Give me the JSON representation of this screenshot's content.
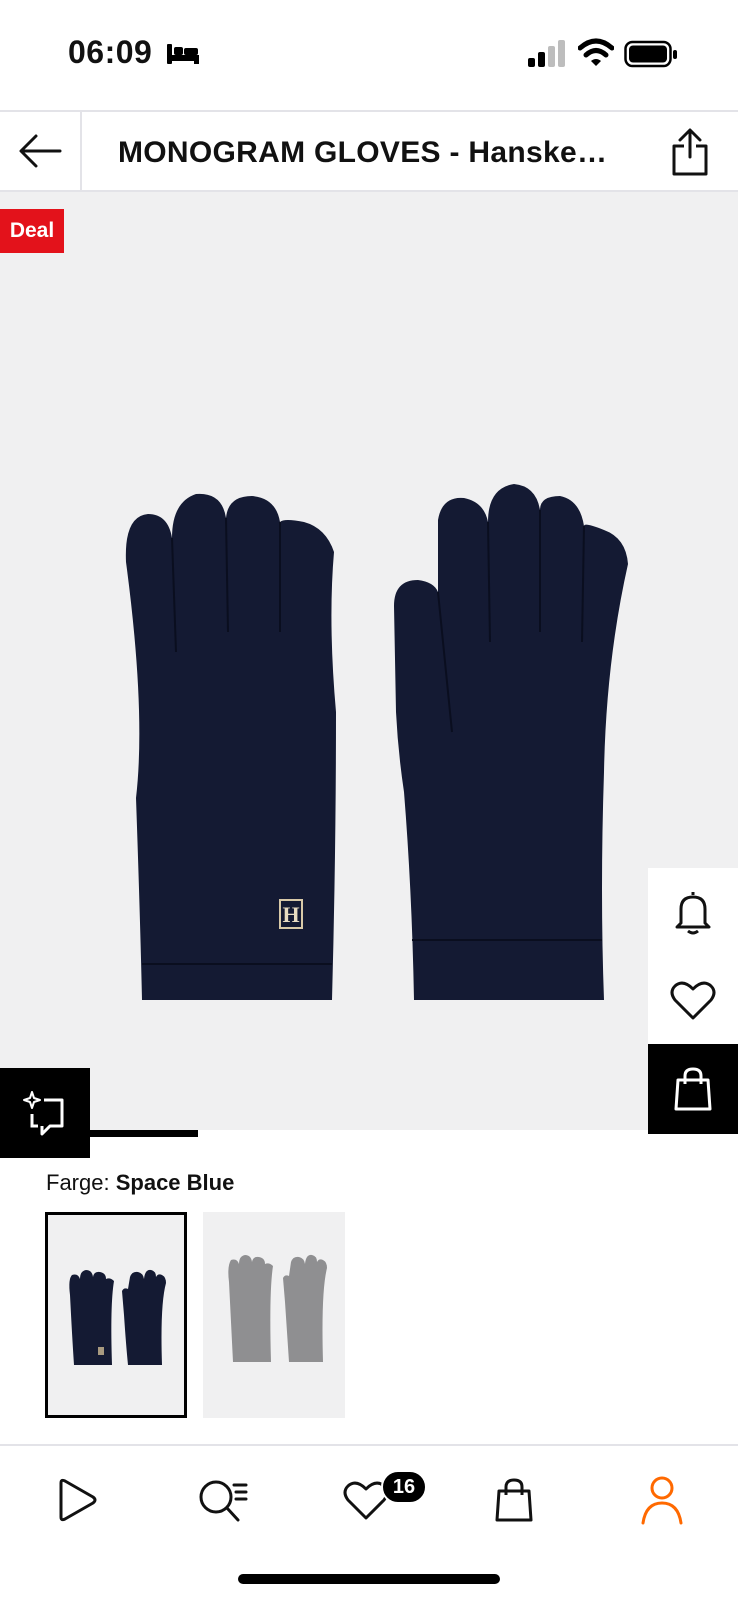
{
  "status_bar": {
    "time": "06:09",
    "icons": [
      "bed-icon",
      "cellular-signal-icon",
      "wifi-icon",
      "battery-icon"
    ]
  },
  "header": {
    "title": "MONOGRAM GLOVES - Hansker - space blue",
    "back_icon": "arrow-left-icon",
    "share_icon": "share-icon"
  },
  "product": {
    "deal_badge": "Deal",
    "image_alt": "Navy knitted gloves with H monogram",
    "gallery_progress": 0.21,
    "side_actions": [
      "bell-icon",
      "heart-icon",
      "shopping-bag-icon"
    ],
    "similar_icon": "sparkle-frame-icon"
  },
  "color_selector": {
    "label": "Farge:",
    "selected": "Space Blue",
    "swatches": [
      {
        "name": "Space Blue",
        "color": "#141a33",
        "selected": true
      },
      {
        "name": "Grey",
        "color": "#8f8f91",
        "selected": false
      }
    ]
  },
  "bottom_nav": {
    "items": [
      "play-icon",
      "search-list-icon",
      "heart-icon",
      "shopping-bag-icon",
      "user-icon"
    ],
    "wishlist_count": "16",
    "active_color": "#ff6900"
  },
  "colors": {
    "deal_red": "#e3121b",
    "glove_navy": "#141a33",
    "image_bg": "#f0f0f1"
  }
}
